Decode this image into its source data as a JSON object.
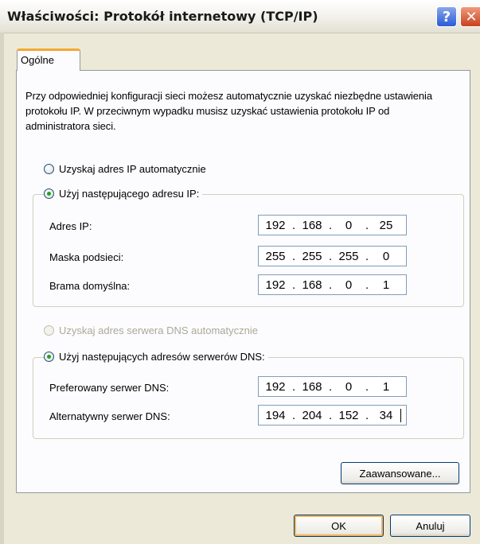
{
  "window": {
    "title": "Właściwości: Protokół internetowy (TCP/IP)",
    "help_glyph": "?",
    "close_glyph": "✕"
  },
  "tabs": [
    {
      "label": "Ogólne",
      "active": true
    }
  ],
  "intro_text": "Przy odpowiedniej konfiguracji sieci możesz automatycznie uzyskać niezbędne ustawienia protokołu IP. W przeciwnym wypadku musisz uzyskać ustawienia protokołu IP od administratora sieci.",
  "ip_mode": {
    "auto_label": "Uzyskaj adres IP automatycznie",
    "manual_label": "Użyj następującego adresu IP:",
    "selected": "manual"
  },
  "ip_fields": [
    {
      "label": "Adres IP:",
      "octets": [
        "192",
        "168",
        "0",
        "25"
      ]
    },
    {
      "label": "Maska podsieci:",
      "octets": [
        "255",
        "255",
        "255",
        "0"
      ]
    },
    {
      "label": "Brama domyślna:",
      "octets": [
        "192",
        "168",
        "0",
        "1"
      ]
    }
  ],
  "dns_mode": {
    "auto_label": "Uzyskaj adres serwera DNS automatycznie",
    "manual_label": "Użyj następujących adresów serwerów DNS:",
    "selected": "manual",
    "auto_disabled": true
  },
  "dns_fields": [
    {
      "label": "Preferowany serwer DNS:",
      "octets": [
        "192",
        "168",
        "0",
        "1"
      ]
    },
    {
      "label": "Alternatywny serwer DNS:",
      "octets": [
        "194",
        "204",
        "152",
        "34"
      ]
    }
  ],
  "buttons": {
    "advanced": "Zaawansowane...",
    "ok": "OK",
    "cancel": "Anuluj"
  },
  "colors": {
    "tab_accent": "#f7a72f",
    "radio_dot": "#21a121",
    "field_border": "#7f9db9",
    "dialog_bg": "#ece9d8"
  }
}
